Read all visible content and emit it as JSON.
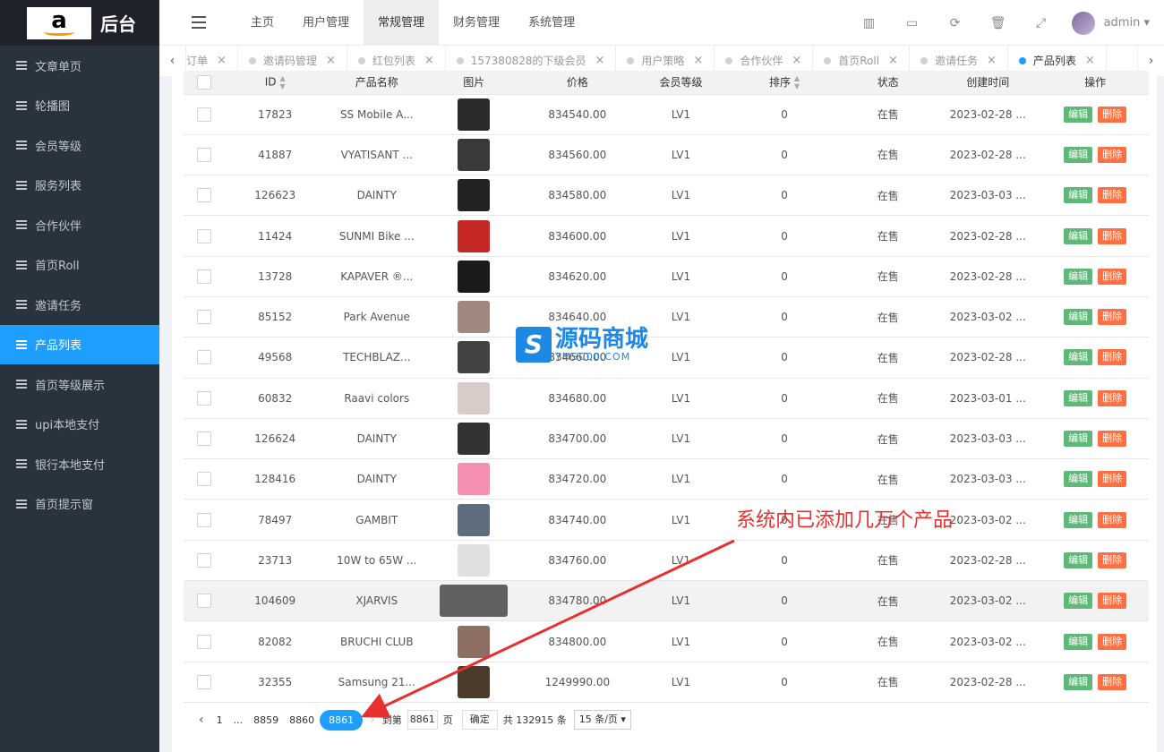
{
  "logo": {
    "title": "后台"
  },
  "sidebar": {
    "items": [
      {
        "label": "文章单页",
        "name": "sidebar-item-articles"
      },
      {
        "label": "轮播图",
        "name": "sidebar-item-carousel"
      },
      {
        "label": "会员等级",
        "name": "sidebar-item-member-levels"
      },
      {
        "label": "服务列表",
        "name": "sidebar-item-services"
      },
      {
        "label": "合作伙伴",
        "name": "sidebar-item-partners"
      },
      {
        "label": "首页Roll",
        "name": "sidebar-item-home-roll"
      },
      {
        "label": "邀请任务",
        "name": "sidebar-item-invite-tasks"
      },
      {
        "label": "产品列表",
        "name": "sidebar-item-products",
        "active": true
      },
      {
        "label": "首页等级展示",
        "name": "sidebar-item-home-levels"
      },
      {
        "label": "upi本地支付",
        "name": "sidebar-item-upi-pay"
      },
      {
        "label": "银行本地支付",
        "name": "sidebar-item-bank-pay"
      },
      {
        "label": "首页提示窗",
        "name": "sidebar-item-home-popup"
      }
    ]
  },
  "header": {
    "nav": [
      {
        "label": "主页",
        "name": "nav-home"
      },
      {
        "label": "用户管理",
        "name": "nav-user-management"
      },
      {
        "label": "常规管理",
        "name": "nav-general-management",
        "active": true
      },
      {
        "label": "财务管理",
        "name": "nav-finance-management"
      },
      {
        "label": "系统管理",
        "name": "nav-system-management"
      }
    ],
    "user": "admin"
  },
  "tabs": [
    {
      "label": "订单",
      "active": false
    },
    {
      "label": "邀请码管理",
      "active": false
    },
    {
      "label": "红包列表",
      "active": false
    },
    {
      "label": "157380828的下级会员",
      "active": false
    },
    {
      "label": "用户策略",
      "active": false
    },
    {
      "label": "合作伙伴",
      "active": false
    },
    {
      "label": "首页Roll",
      "active": false
    },
    {
      "label": "邀请任务",
      "active": false
    },
    {
      "label": "产品列表",
      "active": true
    }
  ],
  "table": {
    "columns": [
      "ID",
      "产品名称",
      "图片",
      "价格",
      "会员等级",
      "排序",
      "状态",
      "创建时间",
      "操作"
    ],
    "edit_label": "编辑",
    "delete_label": "删除",
    "rows": [
      {
        "id": "17823",
        "name": "SS Mobile A...",
        "price": "834540.00",
        "level": "LV1",
        "sort": "0",
        "status": "在售",
        "created": "2023-02-28 ...",
        "img": "#2b2b2b"
      },
      {
        "id": "41887",
        "name": "VYATISANT ...",
        "price": "834560.00",
        "level": "LV1",
        "sort": "0",
        "status": "在售",
        "created": "2023-02-28 ...",
        "img": "#3a3a3a"
      },
      {
        "id": "126623",
        "name": "DAINTY",
        "price": "834580.00",
        "level": "LV1",
        "sort": "0",
        "status": "在售",
        "created": "2023-03-03 ...",
        "img": "#222222"
      },
      {
        "id": "11424",
        "name": "SUNMI Bike ...",
        "price": "834600.00",
        "level": "LV1",
        "sort": "0",
        "status": "在售",
        "created": "2023-02-28 ...",
        "img": "#c62828"
      },
      {
        "id": "13728",
        "name": "KAPAVER ®...",
        "price": "834620.00",
        "level": "LV1",
        "sort": "0",
        "status": "在售",
        "created": "2023-02-28 ...",
        "img": "#1a1a1a"
      },
      {
        "id": "85152",
        "name": "Park Avenue",
        "price": "834640.00",
        "level": "LV1",
        "sort": "0",
        "status": "在售",
        "created": "2023-03-02 ...",
        "img": "#a1887f"
      },
      {
        "id": "49568",
        "name": "TECHBLAZ...",
        "price": "834660.00",
        "level": "LV1",
        "sort": "0",
        "status": "在售",
        "created": "2023-02-28 ...",
        "img": "#424242"
      },
      {
        "id": "60832",
        "name": "Raavi colors",
        "price": "834680.00",
        "level": "LV1",
        "sort": "0",
        "status": "在售",
        "created": "2023-03-01 ...",
        "img": "#d7ccc8"
      },
      {
        "id": "126624",
        "name": "DAINTY",
        "price": "834700.00",
        "level": "LV1",
        "sort": "0",
        "status": "在售",
        "created": "2023-03-03 ...",
        "img": "#333333"
      },
      {
        "id": "128416",
        "name": "DAINTY",
        "price": "834720.00",
        "level": "LV1",
        "sort": "0",
        "status": "在售",
        "created": "2023-03-03 ...",
        "img": "#f48fb1"
      },
      {
        "id": "78497",
        "name": "GAMBIT",
        "price": "834740.00",
        "level": "LV1",
        "sort": "0",
        "status": "在售",
        "created": "2023-03-02 ...",
        "img": "#5d6d7e"
      },
      {
        "id": "23713",
        "name": "10W to 65W ...",
        "price": "834760.00",
        "level": "LV1",
        "sort": "0",
        "status": "在售",
        "created": "2023-02-28 ...",
        "img": "#e0e0e0"
      },
      {
        "id": "104609",
        "name": "XJARVIS",
        "price": "834780.00",
        "level": "LV1",
        "sort": "0",
        "status": "在售",
        "created": "2023-03-02 ...",
        "img": "#616161",
        "wide": true,
        "highlight": true
      },
      {
        "id": "82082",
        "name": "BRUCHI CLUB",
        "price": "834800.00",
        "level": "LV1",
        "sort": "0",
        "status": "在售",
        "created": "2023-03-02 ...",
        "img": "#8d6e63"
      },
      {
        "id": "32355",
        "name": "Samsung 21...",
        "price": "1249990.00",
        "level": "LV1",
        "sort": "0",
        "status": "在售",
        "created": "2023-02-28 ...",
        "img": "#4a3b2c"
      }
    ]
  },
  "pager": {
    "first": "1",
    "ellipsis": "...",
    "pages": [
      "8859",
      "8860"
    ],
    "current": "8861",
    "goto_label": "到第",
    "goto_value": "8861",
    "page_unit": "页",
    "confirm": "确定",
    "total": "共 132915 条",
    "page_size": "15 条/页"
  },
  "annotation": "系统内已添加几万个产品",
  "watermark": {
    "cn": "源码商城",
    "en": "YMSC00.COM",
    "s": "S"
  }
}
